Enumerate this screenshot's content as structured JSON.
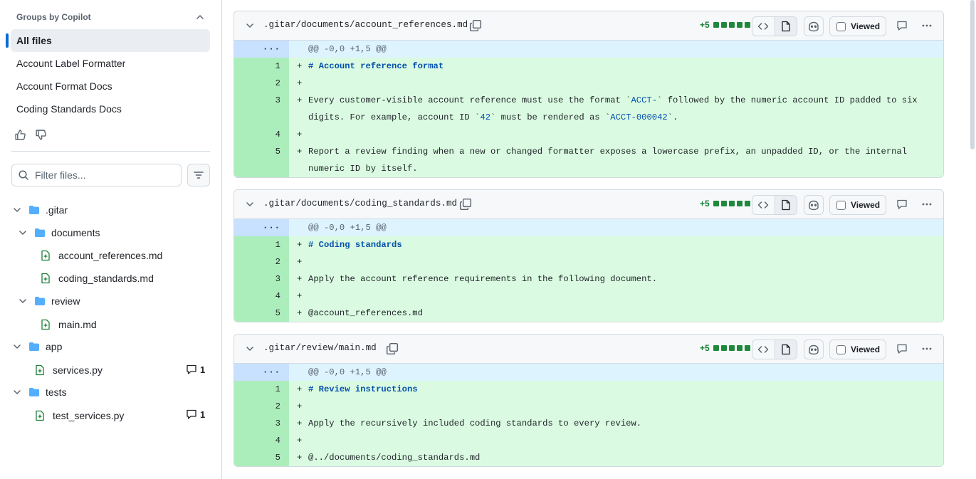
{
  "sidebar": {
    "group_title": "Groups by Copilot",
    "groups": [
      {
        "label": "All files",
        "active": true
      },
      {
        "label": "Account Label Formatter",
        "active": false
      },
      {
        "label": "Account Format Docs",
        "active": false
      },
      {
        "label": "Coding Standards Docs",
        "active": false
      }
    ],
    "filter_placeholder": "Filter files...",
    "tree": [
      {
        "label": ".gitar",
        "kind": "folder"
      },
      {
        "label": "documents",
        "kind": "folder"
      },
      {
        "label": "account_references.md",
        "kind": "file"
      },
      {
        "label": "coding_standards.md",
        "kind": "file"
      },
      {
        "label": "review",
        "kind": "folder"
      },
      {
        "label": "main.md",
        "kind": "file"
      },
      {
        "label": "app",
        "kind": "folder"
      },
      {
        "label": "services.py",
        "kind": "file",
        "comments": "1"
      },
      {
        "label": "tests",
        "kind": "folder"
      },
      {
        "label": "test_services.py",
        "kind": "file",
        "comments": "1"
      }
    ]
  },
  "files": [
    {
      "path": ".gitar/documents/account_references.md",
      "additions": "+5",
      "viewed_label": "Viewed",
      "hunk_marker": "···",
      "hunk": "@@ -0,0 +1,5 @@",
      "lines": [
        {
          "num": "1",
          "text": "# Account reference format"
        },
        {
          "num": "2",
          "text": ""
        },
        {
          "num": "3",
          "text": "Every customer-visible account reference must use the format `ACCT-` followed by the numeric account ID padded to six digits. For example, account ID `42` must be rendered as `ACCT-000042`."
        },
        {
          "num": "4",
          "text": ""
        },
        {
          "num": "5",
          "text": "Report a review finding when a new or changed formatter exposes a lowercase prefix, an unpadded ID, or the internal numeric ID by itself."
        }
      ]
    },
    {
      "path": ".gitar/documents/coding_standards.md",
      "additions": "+5",
      "viewed_label": "Viewed",
      "hunk_marker": "···",
      "hunk": "@@ -0,0 +1,5 @@",
      "lines": [
        {
          "num": "1",
          "text": "# Coding standards"
        },
        {
          "num": "2",
          "text": ""
        },
        {
          "num": "3",
          "text": "Apply the account reference requirements in the following document."
        },
        {
          "num": "4",
          "text": ""
        },
        {
          "num": "5",
          "text": "@account_references.md"
        }
      ]
    },
    {
      "path": ".gitar/review/main.md",
      "additions": "+5",
      "viewed_label": "Viewed",
      "hunk_marker": "···",
      "hunk": "@@ -0,0 +1,5 @@",
      "lines": [
        {
          "num": "1",
          "text": "# Review instructions"
        },
        {
          "num": "2",
          "text": ""
        },
        {
          "num": "3",
          "text": "Apply the recursively included coding standards to every review."
        },
        {
          "num": "4",
          "text": ""
        },
        {
          "num": "5",
          "text": "@../documents/coding_standards.md"
        }
      ]
    }
  ],
  "colors": {
    "accent": "#0969da",
    "added_line_bg": "#dafbe1",
    "added_num_bg": "#aceebb",
    "hunk_bg": "#ddf4ff",
    "addition_green": "#1a7f37"
  },
  "icons": [
    "chevron-up-icon",
    "thumbs-up-icon",
    "thumbs-down-icon",
    "search-icon",
    "filter-icon",
    "chevron-down-icon",
    "folder-icon",
    "file-added-icon",
    "comment-icon",
    "copy-icon",
    "code-icon",
    "file-icon",
    "copilot-icon",
    "kebab-icon"
  ]
}
